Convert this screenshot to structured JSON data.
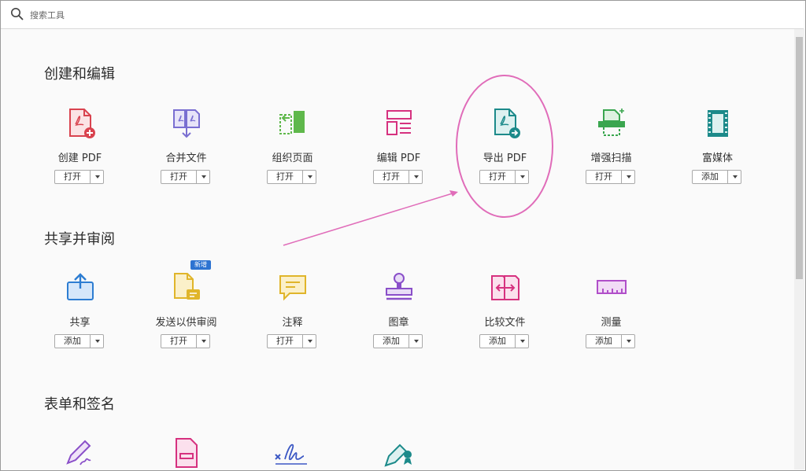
{
  "search": {
    "placeholder": "搜索工具"
  },
  "sections": [
    {
      "title": "创建和编辑"
    },
    {
      "title": "共享并审阅"
    },
    {
      "title": "表单和签名"
    }
  ],
  "create_edit": [
    {
      "label": "创建 PDF",
      "button": "打开",
      "icon": "create-pdf-icon",
      "color": "#d9434f"
    },
    {
      "label": "合并文件",
      "button": "打开",
      "icon": "combine-files-icon",
      "color": "#7a6fd1"
    },
    {
      "label": "组织页面",
      "button": "打开",
      "icon": "organize-pages-icon",
      "color": "#5fb84b"
    },
    {
      "label": "编辑 PDF",
      "button": "打开",
      "icon": "edit-pdf-icon",
      "color": "#d6317f"
    },
    {
      "label": "导出 PDF",
      "button": "打开",
      "icon": "export-pdf-icon",
      "color": "#1c8a8a"
    },
    {
      "label": "增强扫描",
      "button": "打开",
      "icon": "enhance-scan-icon",
      "color": "#3aa64f"
    },
    {
      "label": "富媒体",
      "button": "添加",
      "icon": "rich-media-icon",
      "color": "#1c8a8a"
    }
  ],
  "share_review": [
    {
      "label": "共享",
      "button": "添加",
      "icon": "share-icon",
      "color": "#2d7dd2"
    },
    {
      "label": "发送以供审阅",
      "button": "打开",
      "icon": "send-review-icon",
      "color": "#e0b52a"
    },
    {
      "label": "注释",
      "button": "打开",
      "icon": "comment-icon",
      "color": "#e0b52a"
    },
    {
      "label": "图章",
      "button": "添加",
      "icon": "stamp-icon",
      "color": "#8a4fc9"
    },
    {
      "label": "比较文件",
      "button": "添加",
      "icon": "compare-files-icon",
      "color": "#d6317f"
    },
    {
      "label": "测量",
      "button": "添加",
      "icon": "measure-icon",
      "color": "#b04fc9"
    }
  ],
  "badge_new": "新增",
  "forms_sign_icons": [
    "fill-sign-icon",
    "prepare-form-icon",
    "certificates-sign-icon",
    "certificates-icon"
  ]
}
